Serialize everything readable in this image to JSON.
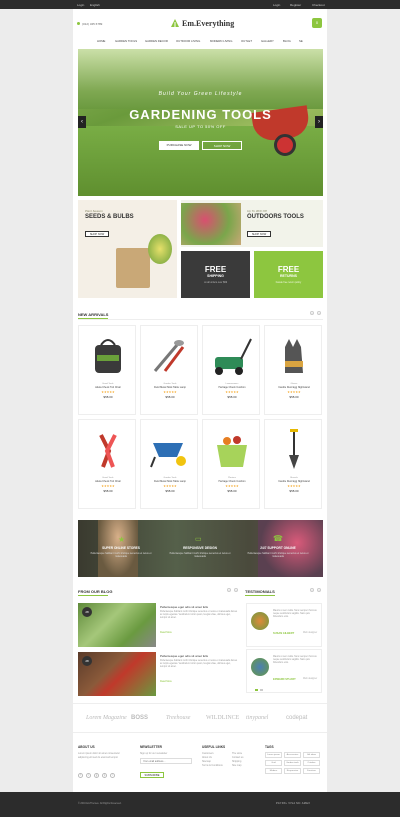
{
  "topbar": {
    "login": "Login",
    "language": "English",
    "login_link": "Login",
    "register": "Register",
    "checkout": "Checkout"
  },
  "header": {
    "phone": "(012) 345 6789",
    "logo": "Em.Everything",
    "cart_count": "0"
  },
  "nav": [
    "HOME",
    "GARDEN TOOLS",
    "GARDEN DECOR",
    "OUTDOOR LIVING",
    "MODERN LIVING",
    "OUTLET",
    "GALLERY",
    "BLOG",
    "SE"
  ],
  "hero": {
    "tagline": "Build Your Green Lifestyle",
    "title": "GARDENING TOOLS",
    "subtitle": "SALE UP TO 50% OFF",
    "btn_purchase": "PURCHASE NOW",
    "btn_shop": "SHOP NOW"
  },
  "banners": {
    "seeds": {
      "small": "Plant Season",
      "title": "SEEDS & BULBS",
      "btn": "SHOP NOW"
    },
    "outdoors": {
      "small": "Up To 30% Off",
      "title": "OUTDOORS TOOLS",
      "btn": "SHOP NOW"
    },
    "shipping": {
      "title": "FREE",
      "sub": "SHIPPING",
      "note": "on all orders over $99"
    },
    "returns": {
      "title": "FREE",
      "sub": "RETURNS",
      "note": "hassle free return policy"
    }
  },
  "new_arrivals": {
    "title": "NEW ARRIVALS",
    "products": [
      {
        "cat": "Hand Tools",
        "name": "Adela Check Tub Chair",
        "price": "$58.00",
        "icon": "tool-bag"
      },
      {
        "cat": "Garden Tools",
        "name": "Field Metal Stick Table Lamp",
        "price": "$58.00",
        "icon": "hand-tools"
      },
      {
        "cat": "Lawnmowers",
        "name": "Heritage Check Cushion",
        "price": "$58.00",
        "icon": "lawnmower"
      },
      {
        "cat": "Gloves",
        "name": "Candle Dust Egg Nightstand",
        "price": "$58.00",
        "icon": "gloves"
      },
      {
        "cat": "Hand Tools",
        "name": "Adela Check Tub Chair",
        "price": "$58.00",
        "icon": "pruner"
      },
      {
        "cat": "Garden Tools",
        "name": "Field Metal Stick Table Lamp",
        "price": "$58.00",
        "icon": "wheelbarrow"
      },
      {
        "cat": "Planters",
        "name": "Heritage Check Cushion",
        "price": "$58.00",
        "icon": "planter"
      },
      {
        "cat": "Shovels",
        "name": "Candle Dust Egg Nightstand",
        "price": "$58.00",
        "icon": "spade"
      }
    ],
    "stars": "★★★★★"
  },
  "services": [
    {
      "title": "SUPER ONLINE STORES",
      "desc": "Pellentesque habitant morbi tristique senectus et netus et malesuada"
    },
    {
      "title": "RESPONSIVE DESIGN",
      "desc": "Pellentesque habitant morbi tristique senectus et netus et malesuada"
    },
    {
      "title": "24/7 SUPPORT ONLINE",
      "desc": "Pellentesque habitant morbi tristique senectus et netus et malesuada"
    }
  ],
  "blog": {
    "title": "FROM OUR BLOG",
    "posts": [
      {
        "day": "28",
        "month": "NOV",
        "title": "Pellentesque eget odio sit amet felis",
        "text": "Pellentesque habitant morbi tristique senectus et netus et malesuada fames ac turpis egestas. Vestibulum tortor quam, feugiat vitae, ultricies eget, tempor sit amet.",
        "more": "Read More"
      },
      {
        "day": "28",
        "month": "NOV",
        "title": "Pellentesque eget odio sit amet felis",
        "text": "Pellentesque habitant morbi tristique senectus et netus et malesuada fames ac turpis egestas. Vestibulum tortor quam, feugiat vitae, ultricies eget, tempor sit amet.",
        "more": "Read More"
      }
    ]
  },
  "testimonials": {
    "title": "TESTIMONIALS",
    "items": [
      {
        "text": "Mauris ut sem nulla. Nunc semper rhoncus neque vestibulum sagittis. Nam quis bibendum eros.",
        "name": "SUSAN GILBERT",
        "role": "Web designer"
      },
      {
        "text": "Mauris ut sem nulla. Nunc semper rhoncus neque vestibulum sagittis. Nam quis bibendum eros.",
        "name": "EDWARD STUART",
        "role": "Web designer"
      }
    ]
  },
  "brands": [
    "Lorem Magazine",
    "BOSS",
    "Treehouse",
    "WILDLINCE",
    "tinypanel",
    "codepat"
  ],
  "footer": {
    "about": {
      "title": "ABOUT US",
      "text": "Lorem ipsum dolor sit amet consectetur adipiscing elit sed do eiusmod tempor"
    },
    "newsletter": {
      "title": "NEWSLETTER",
      "text": "Sign up for our newsletter",
      "placeholder": "Your email address...",
      "btn": "SUBSCRIBE"
    },
    "links": {
      "title": "USEFUL LINKS",
      "col1": [
        "Customers",
        "About Us",
        "Sitemap",
        "Terms & Conditions"
      ],
      "col2": [
        "The store",
        "Contact us",
        "Shipping",
        "Site map"
      ]
    },
    "tags": {
      "title": "TAGS",
      "items": [
        "Lorem ipsum",
        "Accessories",
        "Gift ideas",
        "Grid",
        "Garden tools",
        "Outdoor",
        "Modern",
        "Responsive",
        "Furniture"
      ]
    },
    "copyright": "© 2016 EmThemes. All Rights Reserved.",
    "payments": "PAYPAL  VISA  MC  AMEX"
  }
}
